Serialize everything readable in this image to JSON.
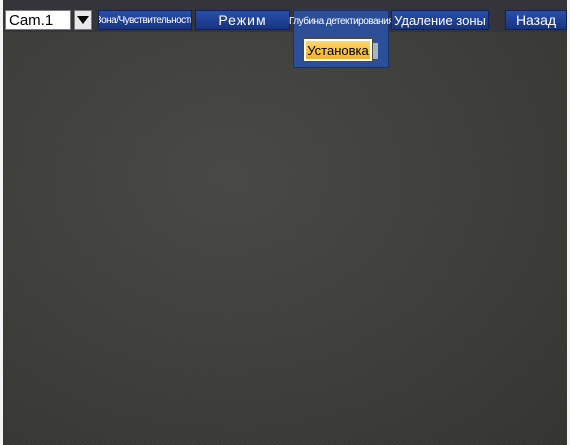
{
  "camera": {
    "selected": "Cam.1",
    "dropdown_icon": "triangle-down-icon"
  },
  "toolbar": {
    "zone_sensitivity": "Зона/Чувствительность",
    "mode": "Режим",
    "detection_depth": "Глубина детектирования",
    "delete_zone": "Удаление зоны",
    "back": "Назад"
  },
  "detection_menu": {
    "setup": "Установка"
  },
  "colors": {
    "button_blue": "#1f419a",
    "highlight": "#f4c24a",
    "video_bg": "#3c3c39"
  }
}
